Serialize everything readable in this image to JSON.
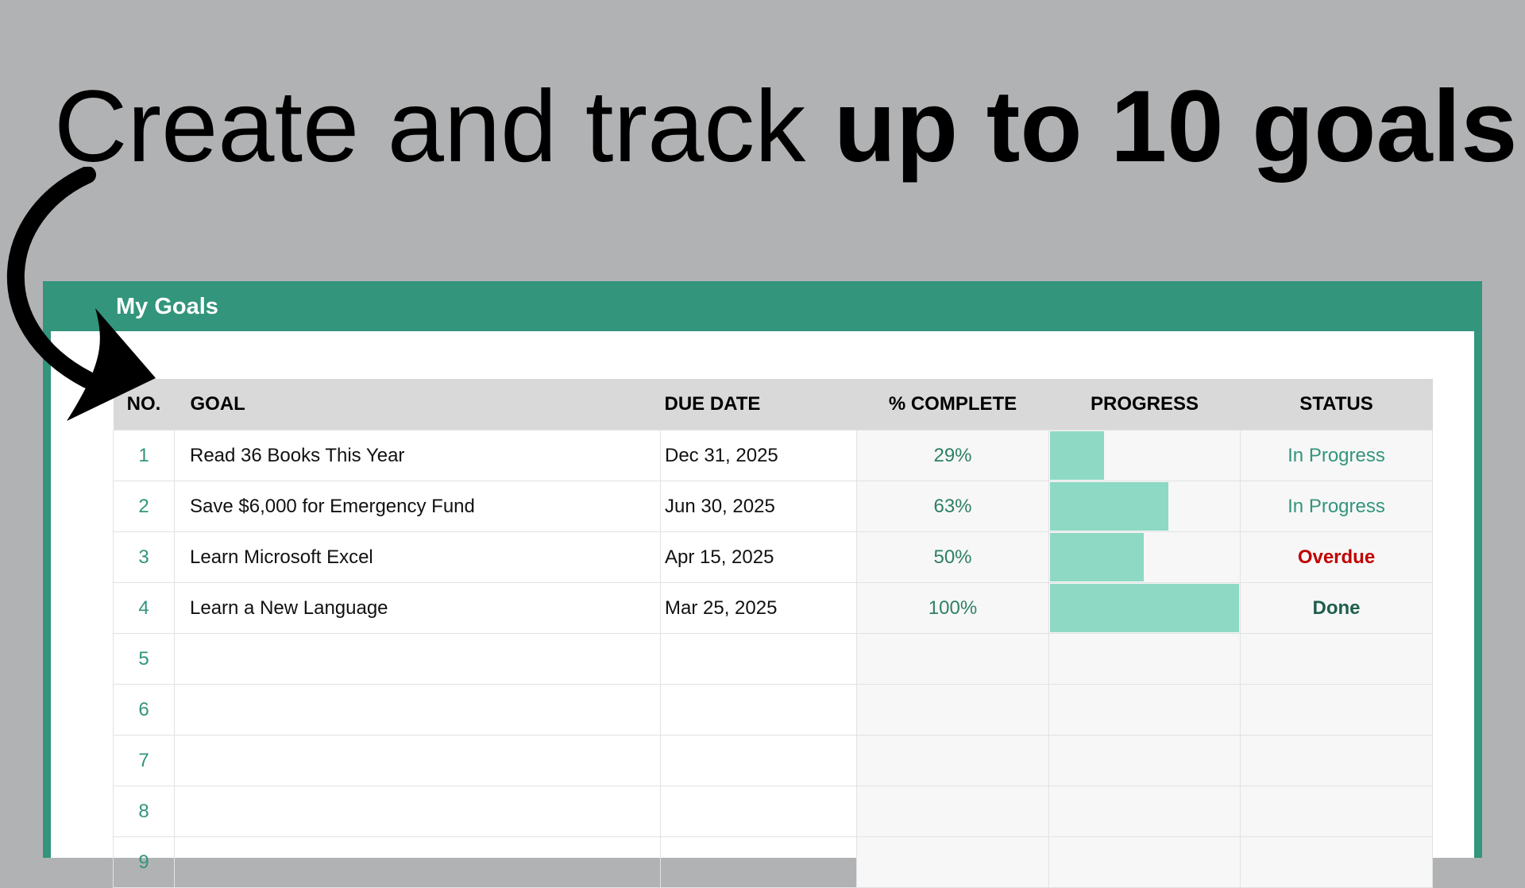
{
  "headline": {
    "prefix": "Create and track ",
    "emphasis": "up to 10 goals",
    "suffix": "!"
  },
  "panel": {
    "title": "My Goals",
    "accent_color": "#32957c",
    "bar_color": "#8dd9c4"
  },
  "table": {
    "headers": {
      "no": "NO.",
      "goal": "GOAL",
      "due": "DUE DATE",
      "pct": "% COMPLETE",
      "progress": "PROGRESS",
      "status": "STATUS"
    },
    "rows": [
      {
        "no": "1",
        "goal": "Read 36 Books This Year",
        "due": "Dec 31, 2025",
        "pct": "29%",
        "progress": 0.29,
        "status": "In Progress",
        "status_kind": "inprogress"
      },
      {
        "no": "2",
        "goal": "Save $6,000 for Emergency Fund",
        "due": "Jun 30, 2025",
        "pct": "63%",
        "progress": 0.63,
        "status": "In Progress",
        "status_kind": "inprogress"
      },
      {
        "no": "3",
        "goal": "Learn Microsoft Excel",
        "due": "Apr 15, 2025",
        "pct": "50%",
        "progress": 0.5,
        "status": "Overdue",
        "status_kind": "overdue"
      },
      {
        "no": "4",
        "goal": "Learn a New Language",
        "due": "Mar 25, 2025",
        "pct": "100%",
        "progress": 1.0,
        "status": "Done",
        "status_kind": "done"
      },
      {
        "no": "5",
        "goal": "",
        "due": "",
        "pct": "",
        "progress": 0,
        "status": "",
        "status_kind": ""
      },
      {
        "no": "6",
        "goal": "",
        "due": "",
        "pct": "",
        "progress": 0,
        "status": "",
        "status_kind": ""
      },
      {
        "no": "7",
        "goal": "",
        "due": "",
        "pct": "",
        "progress": 0,
        "status": "",
        "status_kind": ""
      },
      {
        "no": "8",
        "goal": "",
        "due": "",
        "pct": "",
        "progress": 0,
        "status": "",
        "status_kind": ""
      },
      {
        "no": "9",
        "goal": "",
        "due": "",
        "pct": "",
        "progress": 0,
        "status": "",
        "status_kind": ""
      }
    ]
  }
}
